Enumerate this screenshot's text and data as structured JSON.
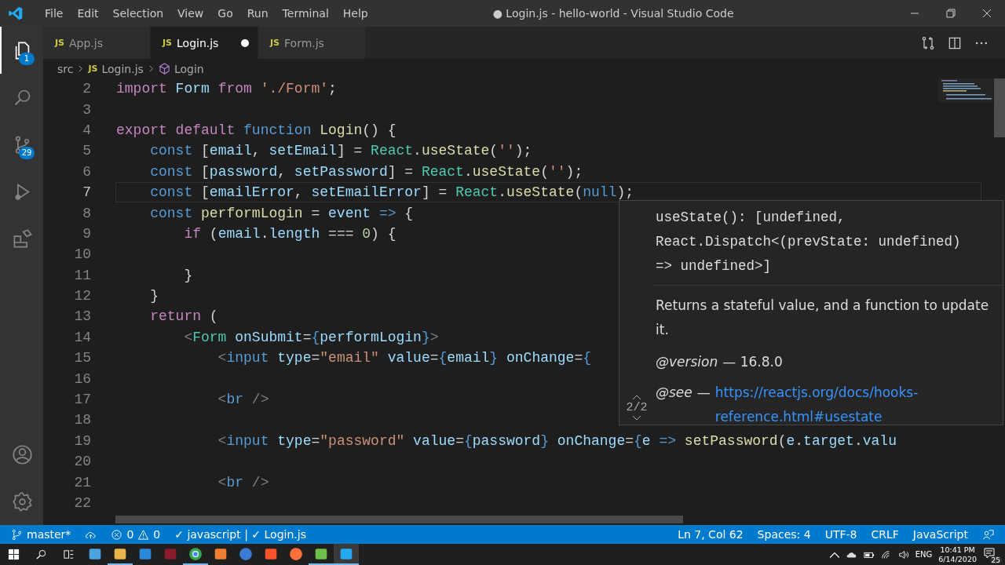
{
  "window": {
    "title": "● Login.js - hello-world - Visual Studio Code"
  },
  "menu": [
    "File",
    "Edit",
    "Selection",
    "View",
    "Go",
    "Run",
    "Terminal",
    "Help"
  ],
  "activity_bar": {
    "top": [
      {
        "kind": "files",
        "badge": "1",
        "selected": true
      },
      {
        "kind": "search",
        "selected": false
      },
      {
        "kind": "source-control",
        "badge": "29",
        "selected": false
      },
      {
        "kind": "run",
        "selected": false
      },
      {
        "kind": "extensions",
        "selected": false
      }
    ],
    "bottom": [
      {
        "kind": "account"
      },
      {
        "kind": "settings"
      }
    ]
  },
  "tabs": [
    {
      "icon": "JS",
      "label": "App.js",
      "selected": false,
      "modified": false
    },
    {
      "icon": "JS",
      "label": "Login.js",
      "selected": true,
      "modified": true
    },
    {
      "icon": "JS",
      "label": "Form.js",
      "selected": false,
      "modified": false
    }
  ],
  "breadcrumb": [
    {
      "kind": "folder",
      "label": "src"
    },
    {
      "kind": "file",
      "icon": "JS",
      "label": "Login.js"
    },
    {
      "kind": "symbol",
      "label": "Login"
    }
  ],
  "editor": {
    "lines": [
      {
        "number": "2",
        "current": false,
        "tokens": [
          {
            "kind": "ctl",
            "text": "import"
          },
          {
            "kind": "var",
            "text": " Form"
          },
          {
            "kind": "ctl",
            "text": " from"
          },
          {
            "kind": "str",
            "text": " './Form'"
          },
          {
            "kind": "p",
            "text": ";"
          }
        ]
      },
      {
        "number": "3",
        "current": false
      },
      {
        "number": "4",
        "current": false,
        "tokens": [
          {
            "kind": "ctl",
            "text": "export"
          },
          {
            "kind": "ctl",
            "text": " default"
          },
          {
            "kind": "kw",
            "text": " function"
          },
          {
            "kind": "fn",
            "text": " Login"
          },
          {
            "kind": "p",
            "text": "() {"
          }
        ]
      },
      {
        "number": "5",
        "current": false,
        "tokens": [
          {
            "kind": "kw",
            "text": "    const"
          },
          {
            "kind": "p",
            "text": " ["
          },
          {
            "kind": "var",
            "text": "email"
          },
          {
            "kind": "p",
            "text": ", "
          },
          {
            "kind": "var",
            "text": "setEmail"
          },
          {
            "kind": "p",
            "text": "] = "
          },
          {
            "kind": "type",
            "text": "React"
          },
          {
            "kind": "p",
            "text": "."
          },
          {
            "kind": "fn",
            "text": "useState"
          },
          {
            "kind": "p",
            "text": "("
          },
          {
            "kind": "str",
            "text": "''"
          },
          {
            "kind": "p",
            "text": ");"
          }
        ]
      },
      {
        "number": "6",
        "current": false,
        "tokens": [
          {
            "kind": "kw",
            "text": "    const"
          },
          {
            "kind": "p",
            "text": " ["
          },
          {
            "kind": "var",
            "text": "password"
          },
          {
            "kind": "p",
            "text": ", "
          },
          {
            "kind": "var",
            "text": "setPassword"
          },
          {
            "kind": "p",
            "text": "] = "
          },
          {
            "kind": "type",
            "text": "React"
          },
          {
            "kind": "p",
            "text": "."
          },
          {
            "kind": "fn",
            "text": "useState"
          },
          {
            "kind": "p",
            "text": "("
          },
          {
            "kind": "str",
            "text": "''"
          },
          {
            "kind": "p",
            "text": ");"
          }
        ]
      },
      {
        "number": "7",
        "current": true,
        "tokens": [
          {
            "kind": "kw",
            "text": "    const"
          },
          {
            "kind": "p",
            "text": " ["
          },
          {
            "kind": "var",
            "text": "emailError"
          },
          {
            "kind": "p",
            "text": ", "
          },
          {
            "kind": "var",
            "text": "setEmailError"
          },
          {
            "kind": "p",
            "text": "] = "
          },
          {
            "kind": "type",
            "text": "React"
          },
          {
            "kind": "p",
            "text": "."
          },
          {
            "kind": "fn",
            "text": "useState"
          },
          {
            "kind": "p",
            "text": "("
          },
          {
            "kind": "kw",
            "text": "null"
          },
          {
            "kind": "p",
            "text": ");"
          }
        ]
      },
      {
        "number": "8",
        "current": false,
        "tokens": [
          {
            "kind": "kw",
            "text": "    const"
          },
          {
            "kind": "fn",
            "text": " performLogin"
          },
          {
            "kind": "p",
            "text": " = "
          },
          {
            "kind": "var",
            "text": "event"
          },
          {
            "kind": "kw",
            "text": " =>"
          },
          {
            "kind": "p",
            "text": " {"
          }
        ]
      },
      {
        "number": "9",
        "current": false,
        "tokens": [
          {
            "kind": "ctl",
            "text": "        if"
          },
          {
            "kind": "p",
            "text": " ("
          },
          {
            "kind": "var",
            "text": "email"
          },
          {
            "kind": "p",
            "text": "."
          },
          {
            "kind": "var",
            "text": "length"
          },
          {
            "kind": "p",
            "text": " === "
          },
          {
            "kind": "num",
            "text": "0"
          },
          {
            "kind": "p",
            "text": ") {"
          }
        ]
      },
      {
        "number": "10",
        "current": false
      },
      {
        "number": "11",
        "current": false,
        "tokens": [
          {
            "kind": "p",
            "text": "        }"
          }
        ]
      },
      {
        "number": "12",
        "current": false,
        "tokens": [
          {
            "kind": "p",
            "text": "    }"
          }
        ]
      },
      {
        "number": "13",
        "current": false,
        "tokens": [
          {
            "kind": "ctl",
            "text": "    return"
          },
          {
            "kind": "p",
            "text": " ("
          }
        ]
      },
      {
        "number": "14",
        "current": false,
        "tokens": [
          {
            "kind": "tagb",
            "text": "        <"
          },
          {
            "kind": "type",
            "text": "Form"
          },
          {
            "kind": "attr",
            "text": " onSubmit"
          },
          {
            "kind": "p",
            "text": "="
          },
          {
            "kind": "kw",
            "text": "{"
          },
          {
            "kind": "var",
            "text": "performLogin"
          },
          {
            "kind": "kw",
            "text": "}"
          },
          {
            "kind": "tagb",
            "text": ">"
          }
        ]
      },
      {
        "number": "15",
        "current": false,
        "tokens": [
          {
            "kind": "tagb",
            "text": "            <"
          },
          {
            "kind": "kw",
            "text": "input"
          },
          {
            "kind": "attr",
            "text": " type"
          },
          {
            "kind": "p",
            "text": "="
          },
          {
            "kind": "str",
            "text": "\"email\""
          },
          {
            "kind": "attr",
            "text": " value"
          },
          {
            "kind": "p",
            "text": "="
          },
          {
            "kind": "kw",
            "text": "{"
          },
          {
            "kind": "var",
            "text": "email"
          },
          {
            "kind": "kw",
            "text": "}"
          },
          {
            "kind": "attr",
            "text": " onChange"
          },
          {
            "kind": "p",
            "text": "="
          },
          {
            "kind": "kw",
            "text": "{"
          }
        ]
      },
      {
        "number": "16",
        "current": false
      },
      {
        "number": "17",
        "current": false,
        "tokens": [
          {
            "kind": "tagb",
            "text": "            <"
          },
          {
            "kind": "kw",
            "text": "br"
          },
          {
            "kind": "tagb",
            "text": " />"
          }
        ]
      },
      {
        "number": "18",
        "current": false
      },
      {
        "number": "19",
        "current": false,
        "tokens": [
          {
            "kind": "tagb",
            "text": "            <"
          },
          {
            "kind": "kw",
            "text": "input"
          },
          {
            "kind": "attr",
            "text": " type"
          },
          {
            "kind": "p",
            "text": "="
          },
          {
            "kind": "str",
            "text": "\"password\""
          },
          {
            "kind": "attr",
            "text": " value"
          },
          {
            "kind": "p",
            "text": "="
          },
          {
            "kind": "kw",
            "text": "{"
          },
          {
            "kind": "var",
            "text": "password"
          },
          {
            "kind": "kw",
            "text": "}"
          },
          {
            "kind": "attr",
            "text": " onChange"
          },
          {
            "kind": "p",
            "text": "="
          },
          {
            "kind": "kw",
            "text": "{"
          },
          {
            "kind": "var",
            "text": "e"
          },
          {
            "kind": "kw",
            "text": " =>"
          },
          {
            "kind": "fn",
            "text": " setPassword"
          },
          {
            "kind": "p",
            "text": "("
          },
          {
            "kind": "var",
            "text": "e"
          },
          {
            "kind": "p",
            "text": "."
          },
          {
            "kind": "var",
            "text": "target"
          },
          {
            "kind": "p",
            "text": "."
          },
          {
            "kind": "var",
            "text": "valu"
          }
        ]
      },
      {
        "number": "20",
        "current": false
      },
      {
        "number": "21",
        "current": false,
        "tokens": [
          {
            "kind": "tagb",
            "text": "            <"
          },
          {
            "kind": "kw",
            "text": "br"
          },
          {
            "kind": "tagb",
            "text": " />"
          }
        ]
      },
      {
        "number": "22",
        "current": false
      }
    ]
  },
  "hover": {
    "signature": [
      "useState(): [undefined,",
      "React.Dispatch<(prevState: undefined)",
      "=> undefined>]"
    ],
    "description": "Returns a stateful value, and a function to update it.",
    "version_tag": "@version",
    "version": "— 16.8.0",
    "see_tag": "@see",
    "see_separator": "—",
    "link": "https://reactjs.org/docs/hooks-reference.html#usestate",
    "counter": "2/2"
  },
  "status_bar": {
    "branch": "master*",
    "errors": "0",
    "warnings": "0",
    "linters": "✓ javascript | ✓ Login.js",
    "right": [
      "Ln 7, Col 62",
      "Spaces: 4",
      "UTF-8",
      "CRLF",
      "JavaScript"
    ]
  },
  "taskbar": {
    "apps": [
      {
        "kind": "computer",
        "running": false
      },
      {
        "kind": "folder",
        "running": true
      },
      {
        "kind": "store",
        "running": false
      },
      {
        "kind": "game",
        "running": false
      },
      {
        "kind": "chrome",
        "running": true
      },
      {
        "kind": "xampp",
        "running": false
      },
      {
        "kind": "hex",
        "running": false
      },
      {
        "kind": "brave",
        "running": false
      },
      {
        "kind": "firefox",
        "running": false
      },
      {
        "kind": "git",
        "running": true
      },
      {
        "kind": "vscode",
        "running": true
      }
    ],
    "language": "ENG",
    "time": "10:41 PM",
    "date": "6/14/2020",
    "notifications": "25"
  }
}
